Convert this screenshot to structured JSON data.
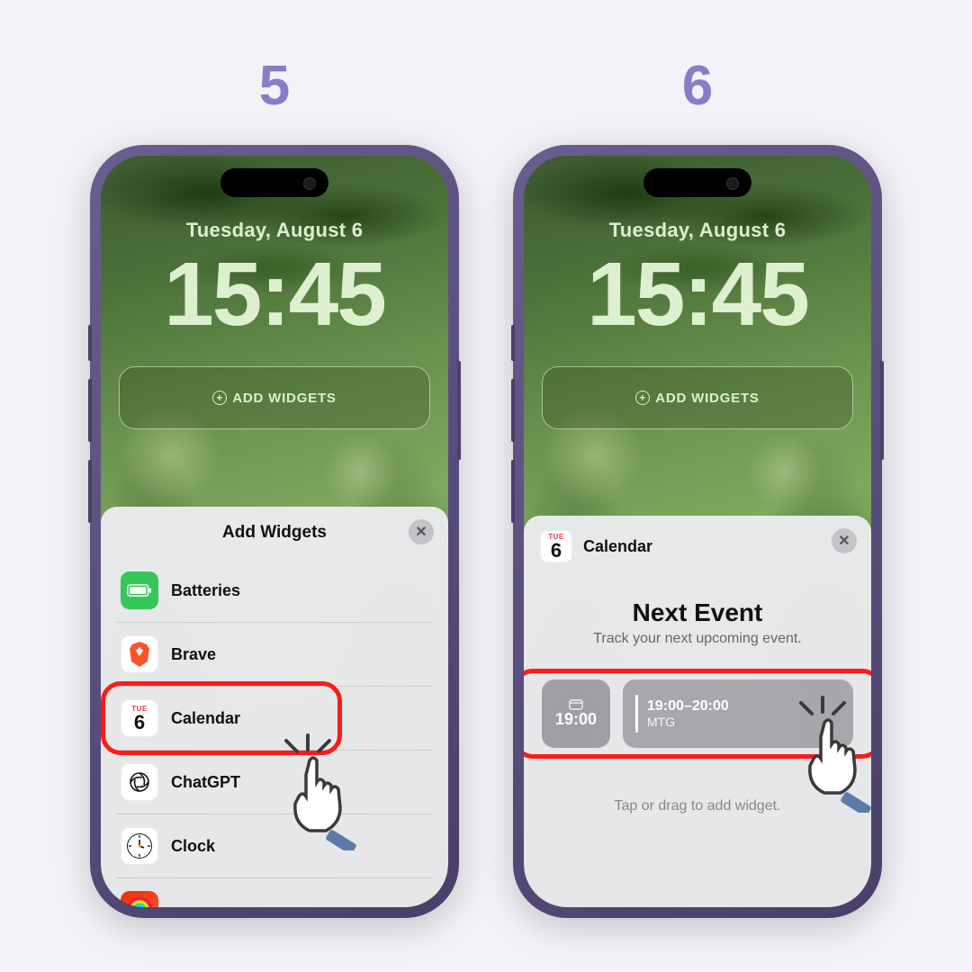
{
  "steps": {
    "left_number": "5",
    "right_number": "6"
  },
  "lockscreen": {
    "date": "Tuesday, August 6",
    "time": "15:45",
    "add_widgets_label": "ADD WIDGETS"
  },
  "sheet_left": {
    "title": "Add Widgets",
    "items": [
      {
        "label": "Batteries"
      },
      {
        "label": "Brave"
      },
      {
        "label": "Calendar",
        "cal_day": "TUE",
        "cal_num": "6"
      },
      {
        "label": "ChatGPT"
      },
      {
        "label": "Clock"
      }
    ]
  },
  "sheet_right": {
    "header_title": "Calendar",
    "cal_day": "TUE",
    "cal_num": "6",
    "next_event_title": "Next Event",
    "next_event_subtitle": "Track your next upcoming event.",
    "preview_small_time": "19:00",
    "preview_large_range": "19:00–20:00",
    "preview_large_title": "MTG",
    "tip": "Tap or drag to add widget."
  }
}
